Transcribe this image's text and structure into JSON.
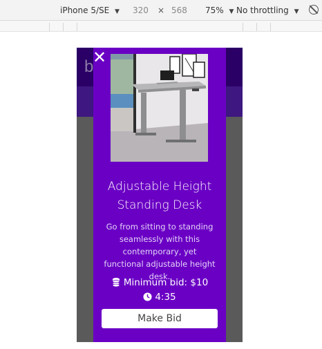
{
  "devtools": {
    "device": "iPhone 5/SE",
    "caret": "▼",
    "width": "320",
    "times": "×",
    "height": "568",
    "zoom": "75%",
    "throttle": "No throttling",
    "rotate_icon": "rotate-icon"
  },
  "page": {
    "header_letter": "b"
  },
  "modal": {
    "close_label": "✕",
    "title": "Adjustable Height Standing Desk",
    "description": "Go from sitting to standing seamlessly with this contemporary, yet functional adjustable height desk.",
    "min_bid": "Minimum bid: $10",
    "time_left": "4:35",
    "button_label": "Make Bid",
    "coins_icon": "coins-icon",
    "clock_icon": "clock-icon"
  },
  "colors": {
    "modal_bg": "#6a00c4",
    "header_bg": "#2b0066",
    "band_bg": "#3e1780",
    "backdrop": "#5a5a5a"
  }
}
